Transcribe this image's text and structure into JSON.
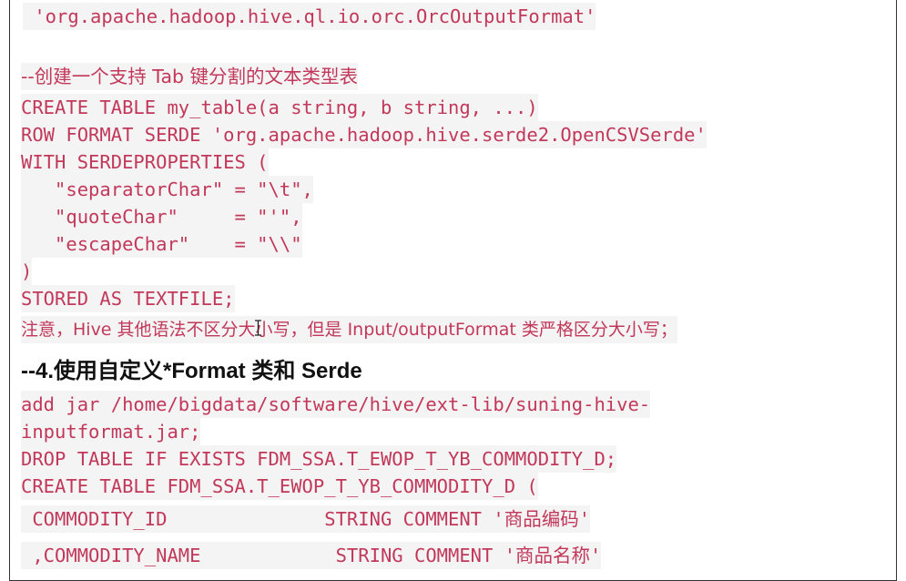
{
  "document": {
    "lines": [
      {
        "text": " 'org.apache.hadoop.hive.ql.io.orc.OrcOutputFormat'",
        "kind": "code"
      },
      {
        "text": "--创建一个支持 Tab 键分割的文本类型表",
        "kind": "comment"
      },
      {
        "text": "CREATE TABLE my_table(a string, b string, ...)",
        "kind": "code"
      },
      {
        "text": "ROW FORMAT SERDE 'org.apache.hadoop.hive.serde2.OpenCSVSerde'",
        "kind": "code"
      },
      {
        "text": "WITH SERDEPROPERTIES (",
        "kind": "code"
      },
      {
        "text": "   \"separatorChar\" = \"\\t\",",
        "kind": "code"
      },
      {
        "text": "   \"quoteChar\"     = \"'\",",
        "kind": "code"
      },
      {
        "text": "   \"escapeChar\"    = \"\\\\\"",
        "kind": "code"
      },
      {
        "text": ")",
        "kind": "code"
      },
      {
        "text": "STORED AS TEXTFILE;",
        "kind": "code"
      },
      {
        "text": "注意，Hive 其他语法不区分大小写，但是 Input/outputFormat 类严格区分大小写；",
        "kind": "note"
      },
      {
        "text": "add jar /home/bigdata/software/hive/ext-lib/suning-hive-",
        "kind": "code"
      },
      {
        "text": "inputformat.jar;",
        "kind": "code"
      },
      {
        "text": "DROP TABLE IF EXISTS FDM_SSA.T_EWOP_T_YB_COMMODITY_D;",
        "kind": "code"
      },
      {
        "text": "CREATE TABLE FDM_SSA.T_EWOP_T_YB_COMMODITY_D (",
        "kind": "code"
      },
      {
        "text": " COMMODITY_ID              STRING COMMENT '商品编码'",
        "kind": "code"
      },
      {
        "text": " ,COMMODITY_NAME            STRING COMMENT '商品名称'",
        "kind": "code"
      }
    ],
    "heading": "--4.使用自定义*Format 类和 Serde"
  }
}
